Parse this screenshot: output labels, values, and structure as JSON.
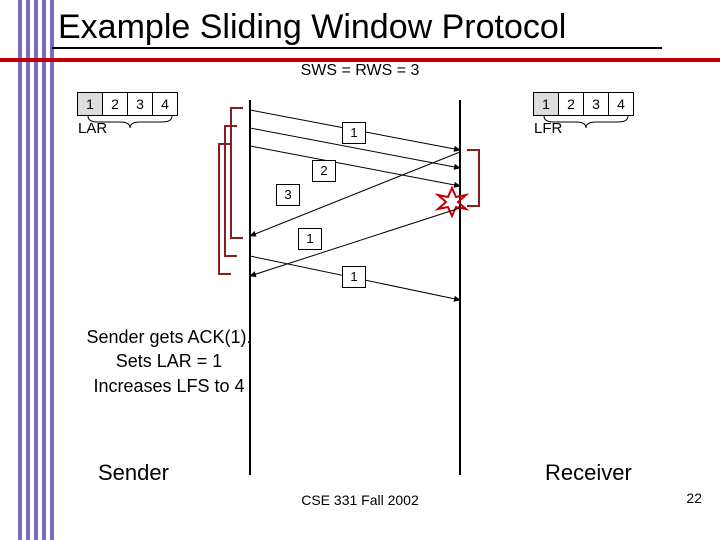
{
  "title": "Example Sliding Window Protocol",
  "subtitle": "SWS = RWS = 3",
  "sender_seq": [
    "1",
    "2",
    "3",
    "4"
  ],
  "receiver_seq": [
    "1",
    "2",
    "3",
    "4"
  ],
  "lar_label": "LAR",
  "lfr_label": "LFR",
  "packet_labels": {
    "p1": "1",
    "p2": "2",
    "p3": "3",
    "ack1": "1",
    "ack1b": "1"
  },
  "sender_note_l1": "Sender gets ACK(1).",
  "sender_note_l2": "Sets LAR = 1",
  "sender_note_l3": "Increases LFS to 4",
  "sender_label": "Sender",
  "receiver_label": "Receiver",
  "footer": "CSE 331 Fall 2002",
  "page_number": "22"
}
